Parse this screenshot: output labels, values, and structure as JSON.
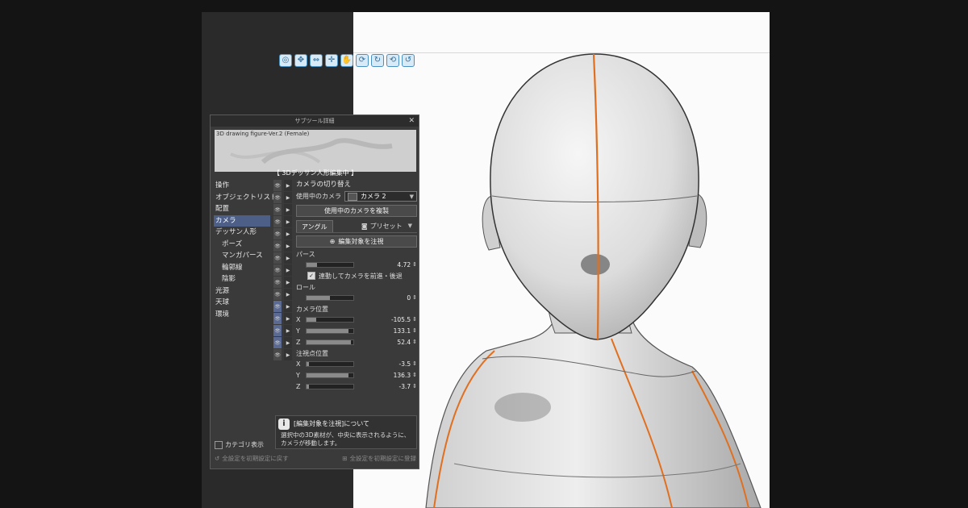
{
  "app": {
    "panel_title": "サブツール詳細",
    "close_icon": "✕",
    "preview_name": "3D drawing figure-Ver.2 (Female)",
    "status_banner": "【 3Dデッサン人形編集中 】"
  },
  "manipulator_icons": [
    "camera-rotate-icon",
    "camera-pan-icon",
    "camera-zoom-icon",
    "move-icon",
    "pan-icon",
    "rotate-x-icon",
    "rotate-y-icon",
    "rotate-z-icon",
    "reset-icon"
  ],
  "categories": [
    {
      "label": "操作",
      "sub": false,
      "selected": false
    },
    {
      "label": "オブジェクトリスト",
      "sub": false,
      "selected": false
    },
    {
      "label": "配置",
      "sub": false,
      "selected": false
    },
    {
      "label": "カメラ",
      "sub": false,
      "selected": true
    },
    {
      "label": "デッサン人形",
      "sub": false,
      "selected": false
    },
    {
      "label": "ポーズ",
      "sub": true,
      "selected": false
    },
    {
      "label": "マンガパース",
      "sub": true,
      "selected": false
    },
    {
      "label": "輪郭線",
      "sub": true,
      "selected": false
    },
    {
      "label": "陰影",
      "sub": true,
      "selected": false
    },
    {
      "label": "光源",
      "sub": false,
      "selected": false
    },
    {
      "label": "天球",
      "sub": false,
      "selected": false
    },
    {
      "label": "環境",
      "sub": false,
      "selected": false
    }
  ],
  "camera": {
    "section_title": "カメラの切り替え",
    "current_label": "使用中のカメラ",
    "current_value": "カメラ 2",
    "duplicate_button": "使用中のカメラを複製"
  },
  "tabs": {
    "angle": "アングル",
    "preset": "プリセット"
  },
  "angle": {
    "focus_button": "編集対象を注視",
    "perspective": {
      "label": "パース",
      "value": "4.72",
      "fill": 0.22
    },
    "link_checkbox": {
      "label": "連動してカメラを前進・後退",
      "checked": true
    },
    "roll": {
      "label": "ロール",
      "value": "0",
      "fill": 0.5
    },
    "camera_position": {
      "label": "カメラ位置",
      "x": {
        "axis": "X",
        "value": "-105.5",
        "fill": 0.2
      },
      "y": {
        "axis": "Y",
        "value": "133.1",
        "fill": 0.9
      },
      "z": {
        "axis": "Z",
        "value": "52.4",
        "fill": 0.95
      }
    },
    "target_position": {
      "label": "注視点位置",
      "x": {
        "axis": "X",
        "value": "-3.5",
        "fill": 0.05
      },
      "y": {
        "axis": "Y",
        "value": "136.3",
        "fill": 0.9
      },
      "z": {
        "axis": "Z",
        "value": "-3.7",
        "fill": 0.05
      }
    }
  },
  "info": {
    "icon": "i",
    "title": "[編集対象を注視]について",
    "text": "選択中の3D素材が、中央に表示されるように、カメラが移動します。"
  },
  "category_toggle": "カテゴリ表示",
  "footer": {
    "reset": "全設定を初期設定に戻す",
    "register": "全設定を初期設定に登録"
  },
  "colors": {
    "accent_line": "#e07020",
    "selection": "#4d5f86",
    "panel_bg": "#3a3a3a"
  }
}
